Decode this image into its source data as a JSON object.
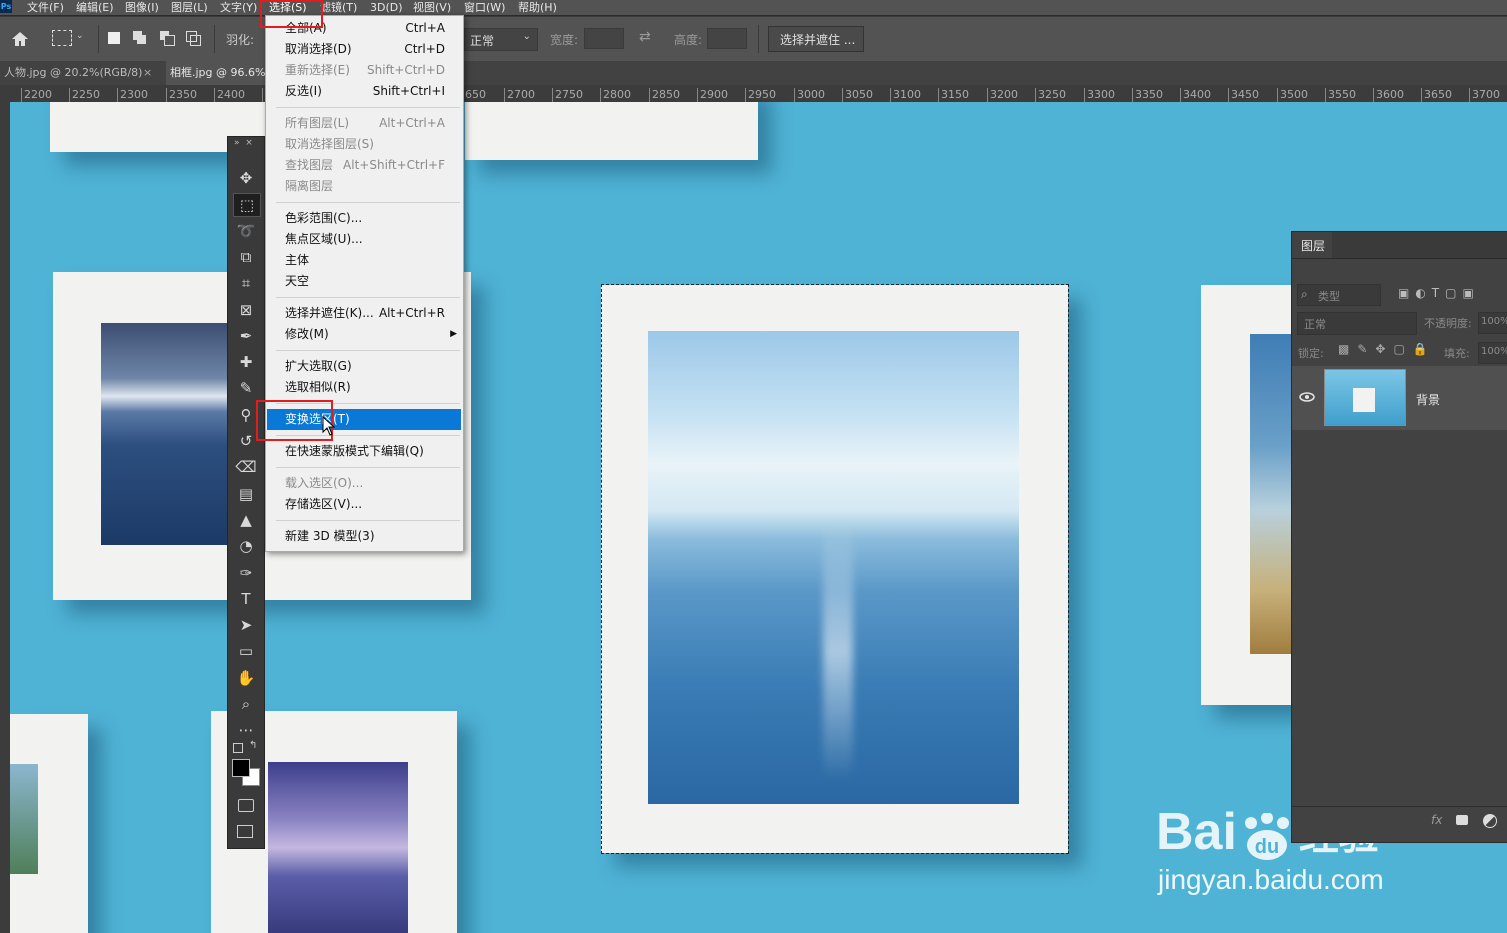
{
  "menubar": {
    "items": [
      "文件(F)",
      "编辑(E)",
      "图像(I)",
      "图层(L)",
      "文字(Y)",
      "选择(S)",
      "滤镜(T)",
      "3D(D)",
      "视图(V)",
      "窗口(W)",
      "帮助(H)"
    ]
  },
  "options": {
    "feather_label": "羽化:",
    "style_value": "正常",
    "width_label": "宽度:",
    "height_label": "高度:",
    "select_mask_button": "选择并遮住 ..."
  },
  "tabs": [
    "人物.jpg @ 20.2%(RGB/8)",
    "相框.jpg @ 96.6%"
  ],
  "tab_close": "×",
  "ruler": {
    "ticks": [
      "2200",
      "2250",
      "2300",
      "2350",
      "2400",
      "",
      "",
      "",
      "",
      "650",
      "2700",
      "2750",
      "2800",
      "2850",
      "2900",
      "2950",
      "3000",
      "3050",
      "3100",
      "3150",
      "3200",
      "3250",
      "3300",
      "3350",
      "3400",
      "3450",
      "3500",
      "3550",
      "3600",
      "3650",
      "3700"
    ]
  },
  "toolbar": {
    "header": "»  ×",
    "tools": [
      "move-tool",
      "marquee-tool",
      "lasso-tool",
      "object-select-tool",
      "crop-tool",
      "frame-tool",
      "eyedropper-tool",
      "healing-tool",
      "brush-tool",
      "stamp-tool",
      "history-brush-tool",
      "eraser-tool",
      "gradient-tool",
      "blur-tool",
      "dodge-tool",
      "pen-tool",
      "type-tool",
      "path-select-tool",
      "shape-tool",
      "hand-tool",
      "zoom-tool",
      "more-tool"
    ]
  },
  "select_menu": {
    "groups": [
      [
        {
          "label": "全部(A)",
          "shortcut": "Ctrl+A",
          "disabled": false
        },
        {
          "label": "取消选择(D)",
          "shortcut": "Ctrl+D",
          "disabled": false
        },
        {
          "label": "重新选择(E)",
          "shortcut": "Shift+Ctrl+D",
          "disabled": true
        },
        {
          "label": "反选(I)",
          "shortcut": "Shift+Ctrl+I",
          "disabled": false
        }
      ],
      [
        {
          "label": "所有图层(L)",
          "shortcut": "Alt+Ctrl+A",
          "disabled": true
        },
        {
          "label": "取消选择图层(S)",
          "shortcut": "",
          "disabled": true
        },
        {
          "label": "查找图层",
          "shortcut": "Alt+Shift+Ctrl+F",
          "disabled": true
        },
        {
          "label": "隔离图层",
          "shortcut": "",
          "disabled": true
        }
      ],
      [
        {
          "label": "色彩范围(C)...",
          "shortcut": "",
          "disabled": false
        },
        {
          "label": "焦点区域(U)...",
          "shortcut": "",
          "disabled": false
        },
        {
          "label": "主体",
          "shortcut": "",
          "disabled": false
        },
        {
          "label": "天空",
          "shortcut": "",
          "disabled": false
        }
      ],
      [
        {
          "label": "选择并遮住(K)...",
          "shortcut": "Alt+Ctrl+R",
          "disabled": false
        },
        {
          "label": "修改(M)",
          "shortcut": "",
          "disabled": false,
          "submenu": true
        }
      ],
      [
        {
          "label": "扩大选取(G)",
          "shortcut": "",
          "disabled": false
        },
        {
          "label": "选取相似(R)",
          "shortcut": "",
          "disabled": false
        }
      ],
      [
        {
          "label": "变换选区(T)",
          "shortcut": "",
          "disabled": false,
          "highlighted": true
        }
      ],
      [
        {
          "label": "在快速蒙版模式下编辑(Q)",
          "shortcut": "",
          "disabled": false
        }
      ],
      [
        {
          "label": "载入选区(O)...",
          "shortcut": "",
          "disabled": true
        },
        {
          "label": "存储选区(V)...",
          "shortcut": "",
          "disabled": false
        }
      ],
      [
        {
          "label": "新建 3D 模型(3)",
          "shortcut": "",
          "disabled": false
        }
      ]
    ]
  },
  "layers_panel": {
    "title": "图层",
    "filter_label": "类型",
    "blend_mode": "正常",
    "opacity_label": "不透明度:",
    "opacity_value": "100%",
    "lock_label": "锁定:",
    "fill_label": "填充:",
    "fill_value": "100%",
    "layer_name": "背景",
    "fx_label": "fx"
  },
  "watermark": {
    "brand": "Bai",
    "suffix": "经验",
    "url": "jingyan.baidu.com"
  },
  "colors": {
    "highlight": "#0a78d7",
    "annotation_red": "#e11d1d",
    "wall": "#4fb3d6"
  }
}
